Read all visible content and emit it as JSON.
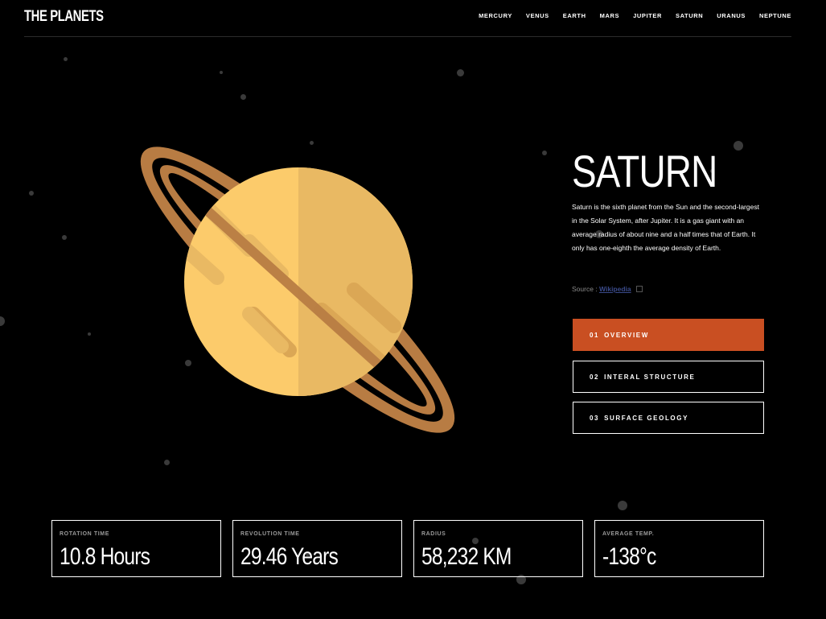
{
  "header": {
    "logo": "THE PLANETS",
    "nav": [
      "MERCURY",
      "VENUS",
      "EARTH",
      "MARS",
      "JUPITER",
      "SATURN",
      "URANUS",
      "NEPTUNE"
    ]
  },
  "planet": {
    "name": "SATURN",
    "description": "Saturn is the sixth planet from the Sun and the second-largest in the Solar System, after Jupiter. It is a gas giant with an average radius of about nine and a half times that of Earth. It only has one-eighth the average density of Earth.",
    "source_label": "Source :",
    "source_link": "Wikipedia"
  },
  "tabs": [
    {
      "num": "01",
      "label": "OVERVIEW"
    },
    {
      "num": "02",
      "label": "INTERAL STRUCTURE"
    },
    {
      "num": "03",
      "label": "SURFACE GEOLOGY"
    }
  ],
  "stats": [
    {
      "label": "ROTATION TIME",
      "value": "10.8 Hours"
    },
    {
      "label": "REVOLUTION TIME",
      "value": "29.46 Years"
    },
    {
      "label": "RADIUS",
      "value": "58,232 KM"
    },
    {
      "label": "AVERAGE TEMP.",
      "value": "-138°c"
    }
  ],
  "colors": {
    "accent": "#c94f22",
    "planet_light": "#fccb6b",
    "planet_dark": "#e9b963",
    "ring": "#b87c43"
  }
}
